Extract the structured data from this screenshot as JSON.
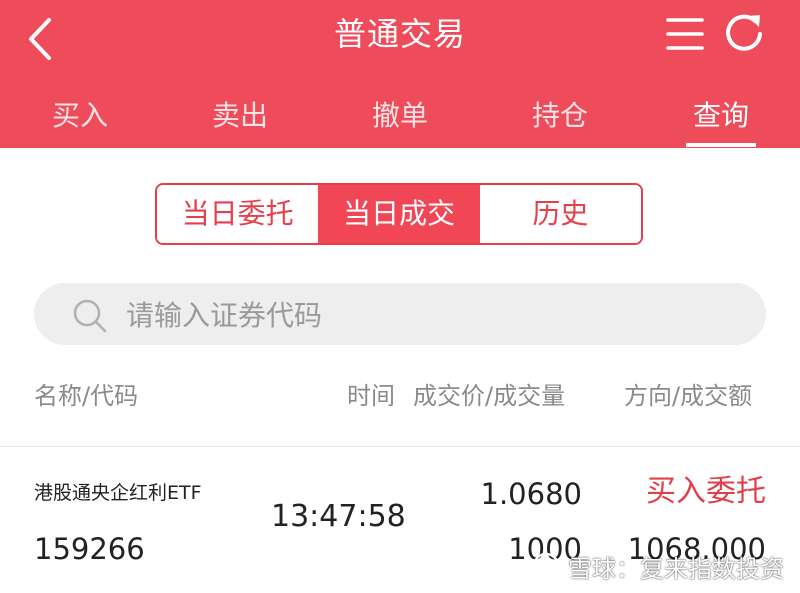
{
  "header": {
    "title": "普通交易",
    "back_icon": "chevron-left-icon",
    "menu_icon": "menu-icon",
    "refresh_icon": "refresh-icon",
    "background_color": "#ef4c5b"
  },
  "tabs": [
    {
      "label": "买入"
    },
    {
      "label": "卖出"
    },
    {
      "label": "撤单"
    },
    {
      "label": "持仓"
    },
    {
      "label": "查询",
      "active": true
    }
  ],
  "segments": [
    {
      "label": "当日委托"
    },
    {
      "label": "当日成交",
      "active": true
    },
    {
      "label": "历史"
    }
  ],
  "search": {
    "placeholder": "请输入证券代码",
    "value": ""
  },
  "table": {
    "headers": {
      "name_code": "名称/代码",
      "time": "时间",
      "price_volume": "成交价/成交量",
      "direction_amount": "方向/成交额"
    },
    "rows": [
      {
        "name": "港股通央企红利ETF",
        "code": "159266",
        "time": "13:47:58",
        "price": "1.0680",
        "volume": "1000",
        "direction": "买入委托",
        "amount": "1068.000"
      }
    ]
  },
  "watermark": {
    "text": "雪球：复来指数投资"
  },
  "colors": {
    "accent": "#ef4c5b",
    "buy": "#e0404c"
  }
}
